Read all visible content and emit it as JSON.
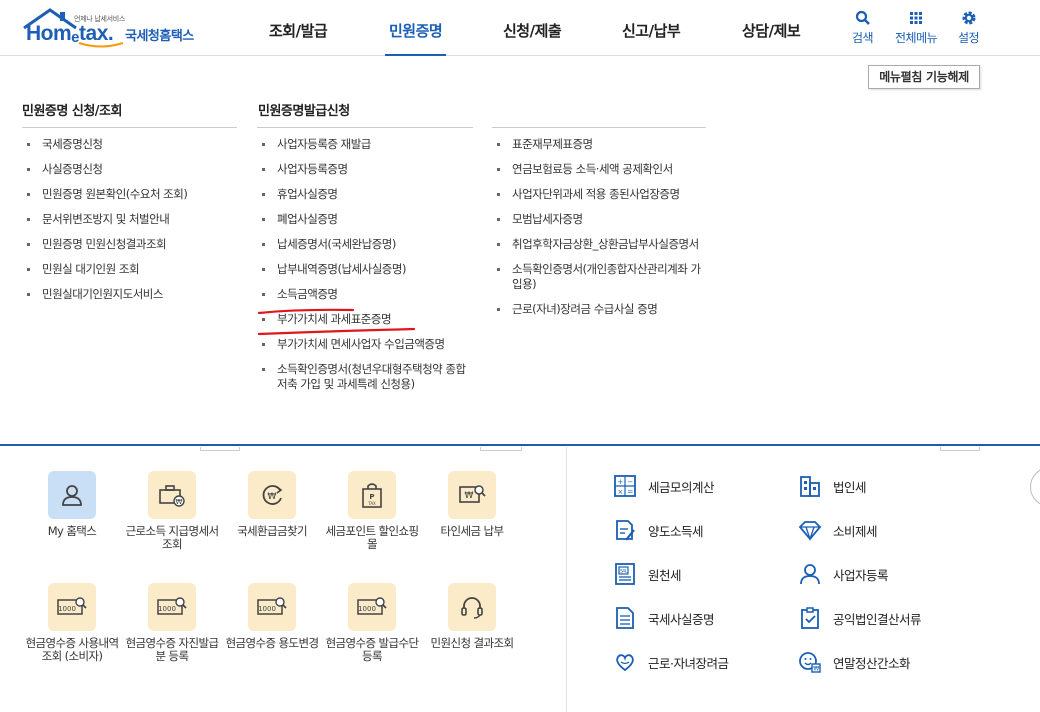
{
  "logo": {
    "tagline": "언제나 납세서비스",
    "brand_left": "Hom",
    "brand_e": "e",
    "brand_right": "tax.",
    "brand_ko": "국세청홈택스"
  },
  "gnb": [
    "조회/발급",
    "민원증명",
    "신청/제출",
    "신고/납부",
    "상담/제보"
  ],
  "gnb_active": "민원증명",
  "util": {
    "search": "검색",
    "all_menu": "전체메뉴",
    "settings": "설정"
  },
  "unpin_label": "메뉴펼침 기능해제",
  "columns": {
    "col1": {
      "title": "민원증명 신청/조회",
      "items": [
        "국세증명신청",
        "사실증명신청",
        "민원증명 원본확인(수요처 조회)",
        "문서위변조방지 및 처벌안내",
        "민원증명 민원신청결과조회",
        "민원실 대기인원 조회",
        "민원실대기인원지도서비스"
      ]
    },
    "col2": {
      "title": "민원증명발급신청",
      "items": [
        "사업자등록증 재발급",
        "사업자등록증명",
        "휴업사실증명",
        "폐업사실증명",
        "납세증명서(국세완납증명)",
        "납부내역증명(납세사실증명)",
        "소득금액증명",
        "부가가치세 과세표준증명",
        "부가가치세 면세사업자 수입금액증명",
        "소득확인증명서(청년우대형주택청약 종합저축 가입 및 과세특례 신청용)"
      ]
    },
    "col3": {
      "items": [
        "표준재무제표증명",
        "연금보험료등 소득·세액 공제확인서",
        "사업자단위과세 적용 종된사업장증명",
        "모범납세자증명",
        "취업후학자금상환_상환금납부사실증명서",
        "소득확인증명서(개인종합자산관리계좌 가입용)",
        "근로(자녀)장려금 수급사실 증명"
      ]
    }
  },
  "services": {
    "row1": [
      {
        "label": "My 홈택스",
        "icon": "user-icon"
      },
      {
        "label": "근로소득 지급명세서 조회",
        "icon": "briefcase-icon"
      },
      {
        "label": "국세환급금찾기",
        "icon": "refund-icon"
      },
      {
        "label": "세금포인트 할인쇼핑몰",
        "icon": "shopping-bag-icon"
      },
      {
        "label": "타인세금 납부",
        "icon": "card-search-icon"
      }
    ],
    "row2": [
      {
        "label": "현금영수증 사용내역조회 (소비자)",
        "icon": "receipt-search-icon"
      },
      {
        "label": "현금영수증 자진발급분 등록",
        "icon": "receipt-search-icon"
      },
      {
        "label": "현금영수증 용도변경",
        "icon": "receipt-search-icon"
      },
      {
        "label": "현금영수증 발급수단 등록",
        "icon": "receipt-search-icon"
      },
      {
        "label": "민원신청 결과조회",
        "icon": "headset-icon"
      }
    ]
  },
  "quick_links": {
    "left": [
      "세금모의계산",
      "양도소득세",
      "원천세",
      "국세사실증명",
      "근로·자녀장려금"
    ],
    "right": [
      "법인세",
      "소비제세",
      "사업자등록",
      "공익법인결산서류",
      "연말정산간소화"
    ]
  },
  "colors": {
    "primary": "#1a5fb4",
    "tile": "#fbebc9",
    "tile_active": "#c9dff6",
    "annotation": "#e0161b"
  }
}
